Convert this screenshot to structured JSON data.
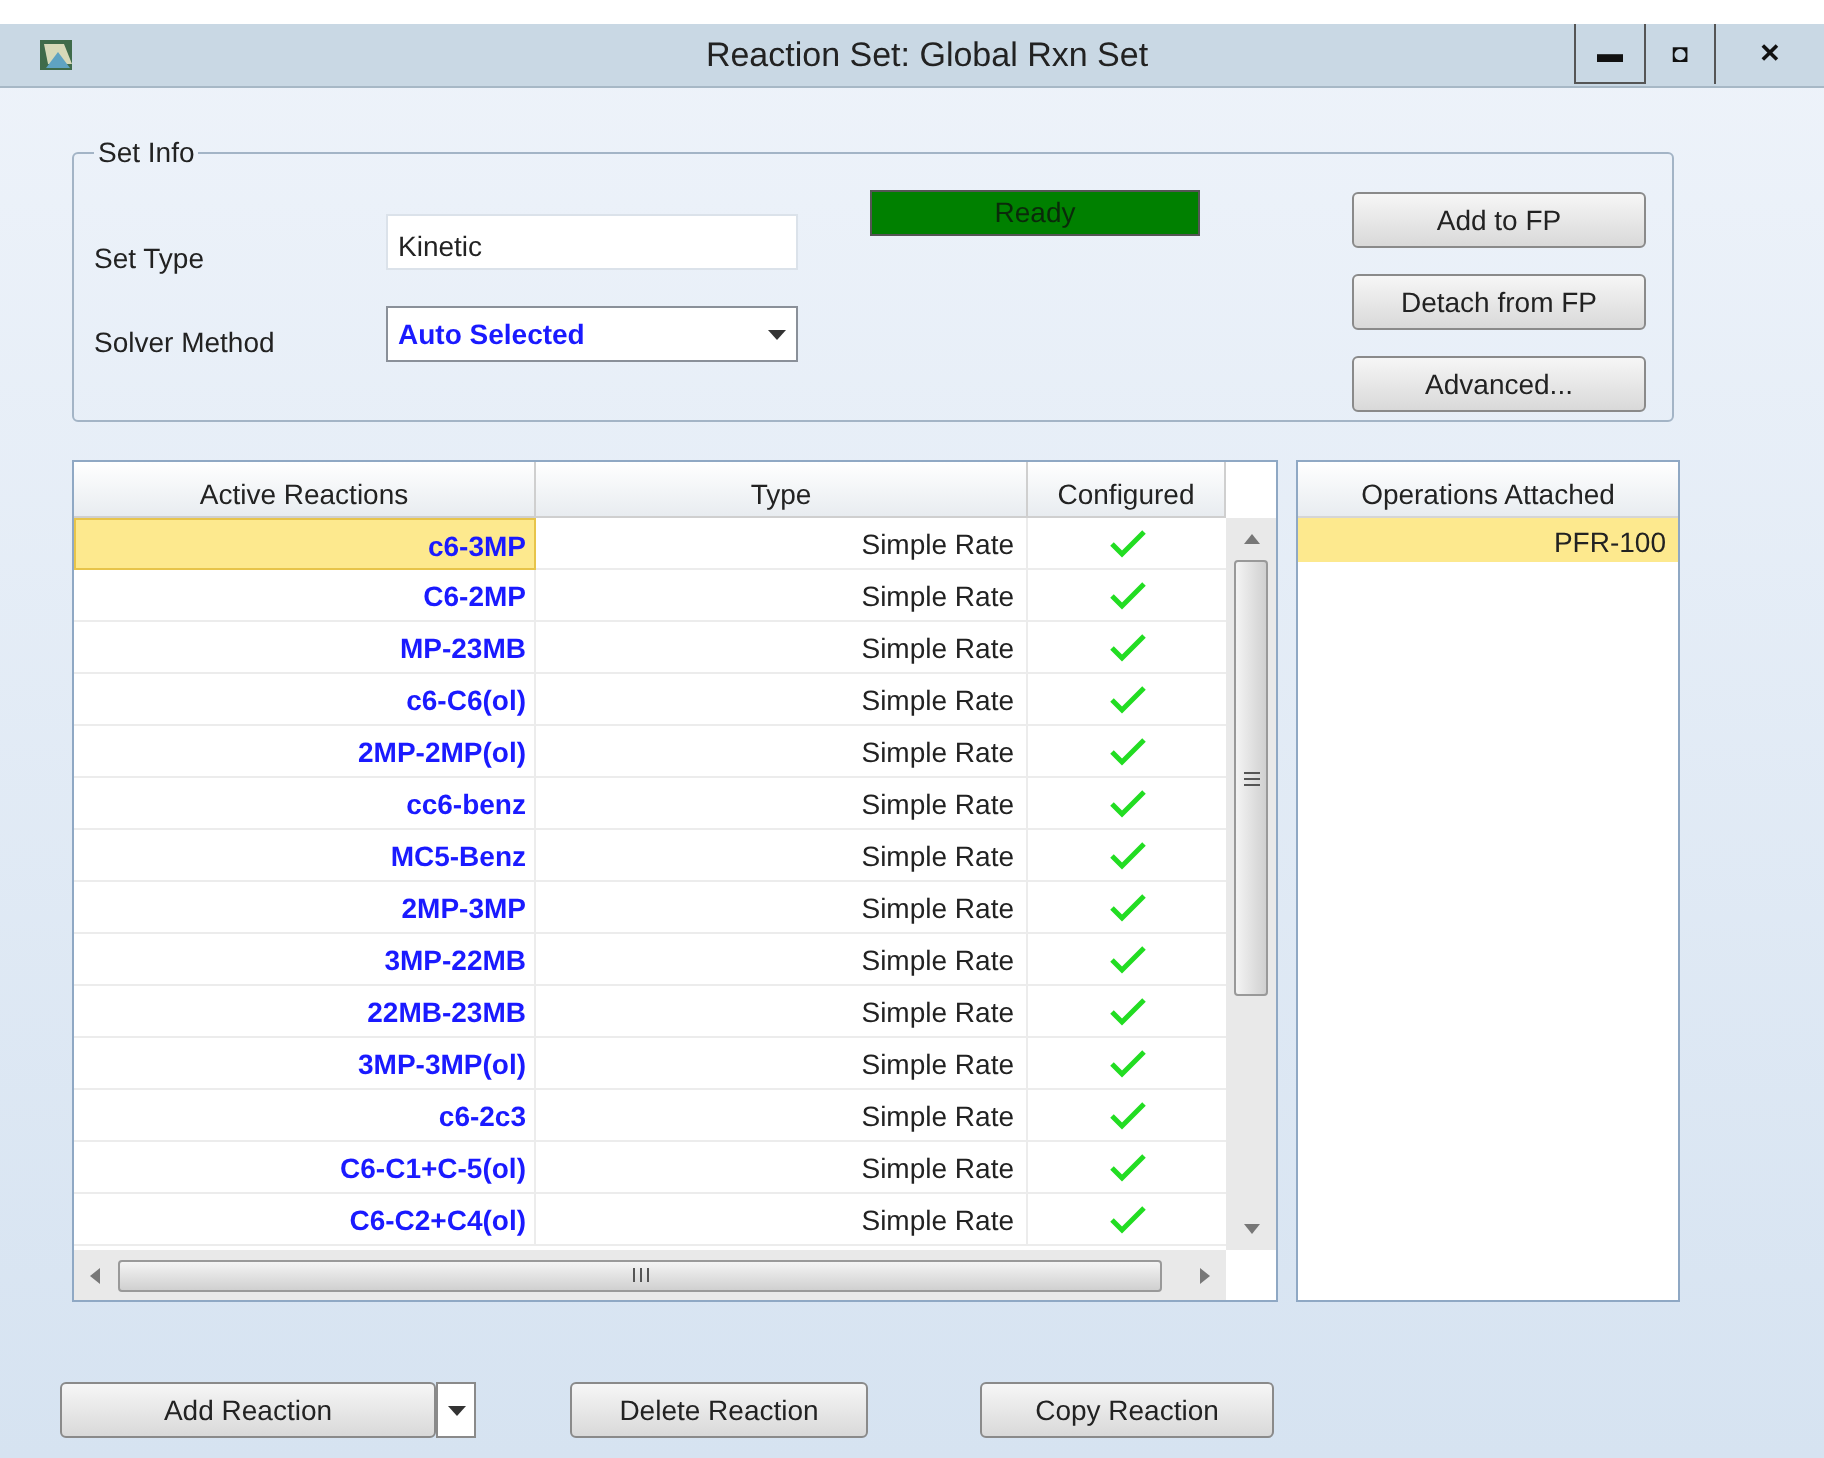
{
  "window": {
    "title": "Reaction Set: Global Rxn Set",
    "controls": [
      "▬",
      "◘",
      "✕"
    ]
  },
  "set_info": {
    "legend": "Set Info",
    "set_type_label": "Set Type",
    "set_type_value": "Kinetic",
    "solver_label": "Solver Method",
    "solver_value": "Auto Selected",
    "status": "Ready",
    "buttons": [
      "Add to FP",
      "Detach from FP",
      "Advanced..."
    ]
  },
  "reactions_table": {
    "columns": [
      "Active Reactions",
      "Type",
      "Configured"
    ],
    "rows": [
      {
        "name": "c6-3MP",
        "type": "Simple Rate",
        "configured": true,
        "selected": true
      },
      {
        "name": "C6-2MP",
        "type": "Simple Rate",
        "configured": true,
        "selected": false
      },
      {
        "name": "MP-23MB",
        "type": "Simple Rate",
        "configured": true,
        "selected": false
      },
      {
        "name": "c6-C6(ol)",
        "type": "Simple Rate",
        "configured": true,
        "selected": false
      },
      {
        "name": "2MP-2MP(ol)",
        "type": "Simple Rate",
        "configured": true,
        "selected": false
      },
      {
        "name": "cc6-benz",
        "type": "Simple Rate",
        "configured": true,
        "selected": false
      },
      {
        "name": "MC5-Benz",
        "type": "Simple Rate",
        "configured": true,
        "selected": false
      },
      {
        "name": "2MP-3MP",
        "type": "Simple Rate",
        "configured": true,
        "selected": false
      },
      {
        "name": "3MP-22MB",
        "type": "Simple Rate",
        "configured": true,
        "selected": false
      },
      {
        "name": "22MB-23MB",
        "type": "Simple Rate",
        "configured": true,
        "selected": false
      },
      {
        "name": "3MP-3MP(ol)",
        "type": "Simple Rate",
        "configured": true,
        "selected": false
      },
      {
        "name": "c6-2c3",
        "type": "Simple Rate",
        "configured": true,
        "selected": false
      },
      {
        "name": "C6-C1+C-5(ol)",
        "type": "Simple Rate",
        "configured": true,
        "selected": false
      },
      {
        "name": "C6-C2+C4(ol)",
        "type": "Simple Rate",
        "configured": true,
        "selected": false
      }
    ]
  },
  "operations": {
    "column": "Operations Attached",
    "rows": [
      {
        "name": "PFR-100",
        "selected": true
      }
    ]
  },
  "buttons": [
    "Add Reaction",
    "Delete Reaction",
    "Copy Reaction"
  ]
}
